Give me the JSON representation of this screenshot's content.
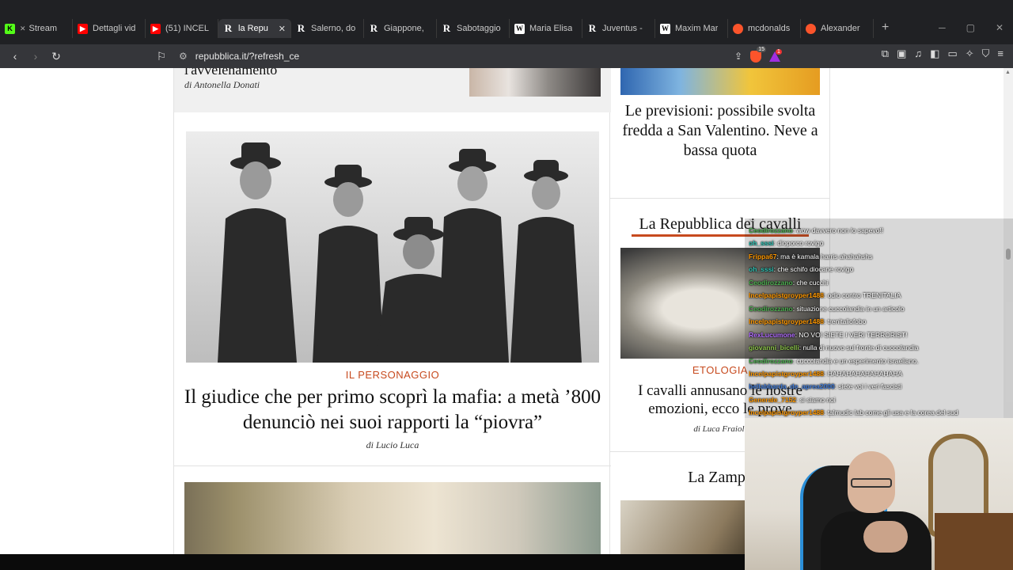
{
  "browser": {
    "tabs": [
      {
        "label": "Stream",
        "icon": "kick-icon",
        "color": "#53fc18",
        "active": false,
        "muted": true
      },
      {
        "label": "Dettagli vid",
        "icon": "youtube-icon",
        "color": "#ff0000",
        "active": false
      },
      {
        "label": "(51) INCEL",
        "icon": "youtube-icon",
        "color": "#ff0000",
        "active": false
      },
      {
        "label": "la Repu",
        "icon": "repubblica-icon",
        "color": "#ffffff",
        "active": true
      },
      {
        "label": "Salerno, do",
        "icon": "repubblica-icon",
        "color": "#ffffff",
        "active": false
      },
      {
        "label": "Giappone,",
        "icon": "repubblica-icon",
        "color": "#ffffff",
        "active": false
      },
      {
        "label": "Sabotaggio",
        "icon": "repubblica-icon",
        "color": "#ffffff",
        "active": false
      },
      {
        "label": "Maria Elisa",
        "icon": "wikipedia-icon",
        "color": "#ffffff",
        "active": false
      },
      {
        "label": "Juventus -",
        "icon": "repubblica-icon",
        "color": "#ffffff",
        "active": false
      },
      {
        "label": "Maxim Mar",
        "icon": "wikipedia-icon",
        "color": "#ffffff",
        "active": false
      },
      {
        "label": "mcdonalds",
        "icon": "brave-search-icon",
        "color": "#fb542b",
        "active": false
      },
      {
        "label": "Alexander",
        "icon": "brave-search-icon",
        "color": "#fb542b",
        "active": false
      }
    ],
    "new_tab": "+",
    "url": "repubblica.it/?refresh_ce",
    "shields_count": "15",
    "rewards_count": "1"
  },
  "page": {
    "prev_story": {
      "title": "l'avvelenamento",
      "author": "di Antonella Donati"
    },
    "main_story": {
      "kicker": "IL PERSONAGGIO",
      "headline": "Il giudice che per primo scoprì la mafia: a metà ’800 denunciò nei suoi rapporti la “piovra”",
      "byline": "di Lucio Luca"
    },
    "forecast": {
      "title": "Le previsioni: possibile svolta fredda a San Valentino. Neve a bassa quota"
    },
    "cavalli": {
      "section": "La Repubblica dei cavalli",
      "kicker": "ETOLOGIA",
      "title": "I cavalli annusano le nostre emozioni, ecco le prove",
      "author": "di Luca Fraioli"
    },
    "zampa": {
      "section": "La Zampa"
    }
  },
  "chat": {
    "messages": [
      {
        "user": "",
        "text": "...",
        "color": "#ffffff"
      },
      {
        "user": "Ceodirozzano",
        "text": ": wow davvero non lo sapevo!!",
        "color": "#4caf50"
      },
      {
        "user": "oh_sssi",
        "text": ": dioporco rovigo",
        "color": "#2ec4b6"
      },
      {
        "user": "Frippa67",
        "text": ": ma è kamala harris ahahahshs",
        "color": "#ff9800"
      },
      {
        "user": "oh_sssi",
        "text": ": che schifo diocane rovigo",
        "color": "#2ec4b6"
      },
      {
        "user": "Ceodirozzano",
        "text": ": che cucchi",
        "color": "#4caf50"
      },
      {
        "user": "Incelpapistgroyper1488",
        "text": ": odio contro TRENITALIA",
        "color": "#ff9800"
      },
      {
        "user": "Ceodirozzano",
        "text": ": situazione cuccolandia in un articolo",
        "color": "#4caf50"
      },
      {
        "user": "Incelpapistgroyper1488",
        "text": ": trenitaliofobo",
        "color": "#ff9800"
      },
      {
        "user": "RexLucumone",
        "text": ": NO VOI SIETE I VERI TERRORIST!",
        "color": "#b16cff"
      },
      {
        "user": "giovanni_bicelli",
        "text": ": nulla di nuovo sul fronte di cuccolandia",
        "color": "#8bc34a"
      },
      {
        "user": "Ceodirozzano",
        "text": ": cuccolandia e un esperimento israeliano.",
        "color": "#4caf50"
      },
      {
        "user": "Incelpapistgroyper1488",
        "text": ": HAHAHAHAHAHAHAHA",
        "color": "#ff9800"
      },
      {
        "user": "bellabbarda_de_aprea2000",
        "text": ": siete voi i veri fascisti",
        "color": "#3f7bd9"
      },
      {
        "user": "Generale_7152",
        "text": ": si siamo noi",
        "color": "#ff9800"
      },
      {
        "user": "Incelpapistgroyper1488",
        "text": ": talmudic lab come gli usa e la corea del sud",
        "color": "#ff9800"
      }
    ]
  },
  "colors": {
    "accent": "#c74a1e",
    "tab_bg": "#202124",
    "toolbar_bg": "#35363a"
  }
}
